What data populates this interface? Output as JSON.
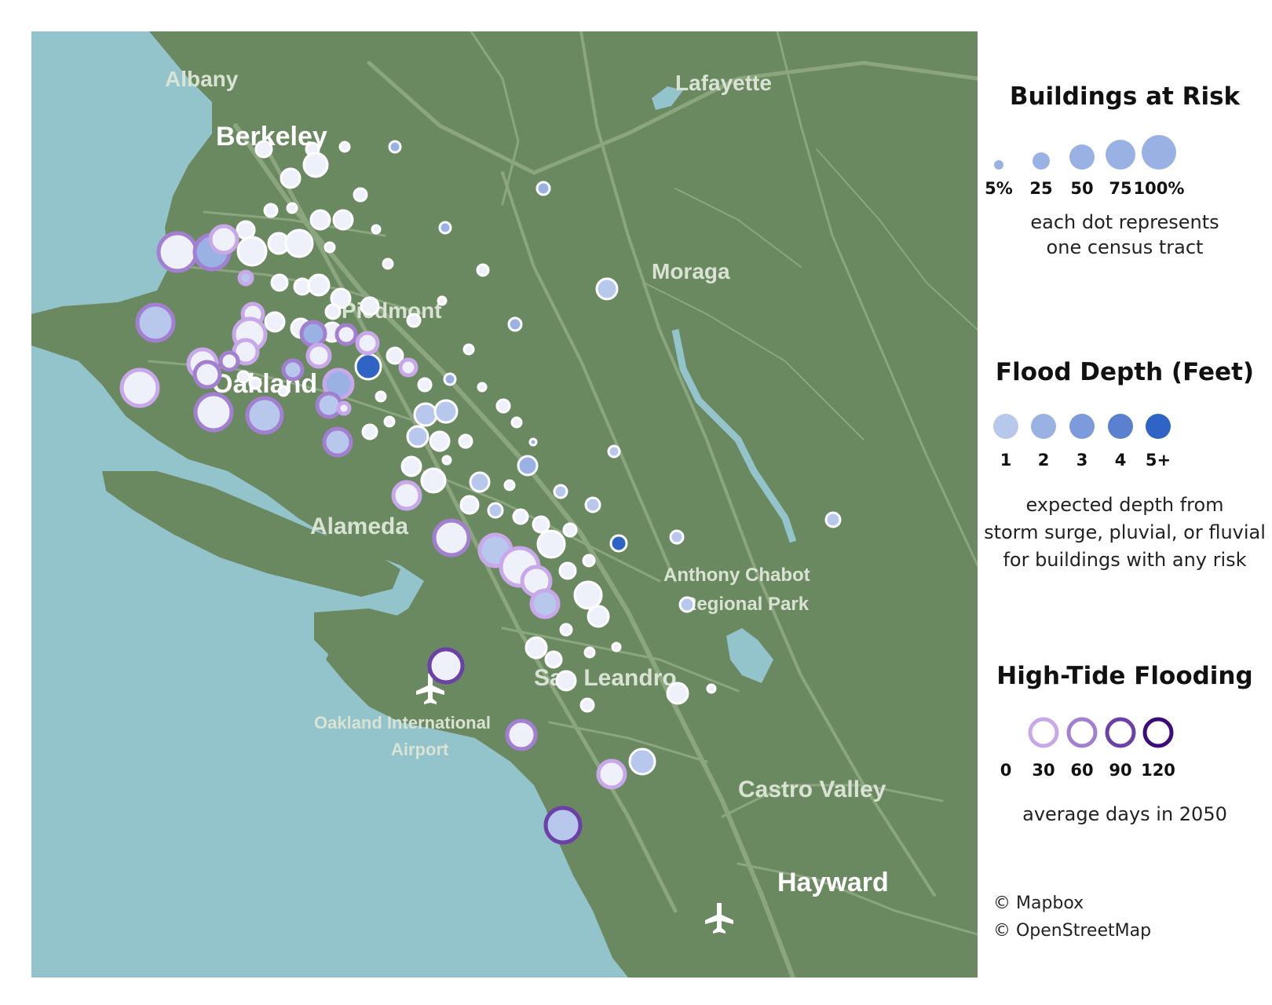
{
  "map": {
    "places": [
      {
        "name": "Albany",
        "cls": "dim"
      },
      {
        "name": "Berkeley",
        "cls": ""
      },
      {
        "name": "Lafayette",
        "cls": "dim"
      },
      {
        "name": "Moraga",
        "cls": "dim"
      },
      {
        "name": "Piedmont",
        "cls": "dim"
      },
      {
        "name": "Oakland",
        "cls": ""
      },
      {
        "name": "Alameda",
        "cls": "dim"
      },
      {
        "name": "Anthony Chabot",
        "cls": "dim"
      },
      {
        "name": "Regional Park",
        "cls": "dim"
      },
      {
        "name": "San Leandro",
        "cls": "dim"
      },
      {
        "name": "Oakland International",
        "cls": "dim"
      },
      {
        "name": "Airport",
        "cls": "dim"
      },
      {
        "name": "Castro Valley",
        "cls": "dim"
      },
      {
        "name": "Hayward",
        "cls": ""
      }
    ],
    "colors": {
      "water": "#93c3cb",
      "land": "#6b8960",
      "road": "#8ba67f",
      "depth": [
        "#eef1fa",
        "#b7c8ec",
        "#9ab1e3",
        "#7c9adc",
        "#5c80d0",
        "#2f63c6"
      ],
      "tide": [
        "#ffffff",
        "#c8a8ea",
        "#a27fd0",
        "#6b40a8",
        "#3b0c7a"
      ]
    }
  },
  "legend": {
    "buildings": {
      "title": "Buildings at Risk",
      "labels": [
        "5%",
        "25",
        "50",
        "75",
        "100%"
      ],
      "note": [
        "each dot represents",
        "one census tract"
      ]
    },
    "depth": {
      "title": "Flood Depth (Feet)",
      "labels": [
        "1",
        "2",
        "3",
        "4",
        "5+"
      ],
      "note": [
        "expected depth from",
        "storm surge, pluvial, or fluvial",
        "for buildings with any risk"
      ]
    },
    "tide": {
      "title": "High-Tide Flooding",
      "labels": [
        "0",
        "30",
        "60",
        "90",
        "120"
      ],
      "note": [
        "average days in 2050"
      ]
    }
  },
  "credits": {
    "mapbox": "© Mapbox",
    "osm": "© OpenStreetMap"
  },
  "icons": [
    "airport-icon"
  ]
}
